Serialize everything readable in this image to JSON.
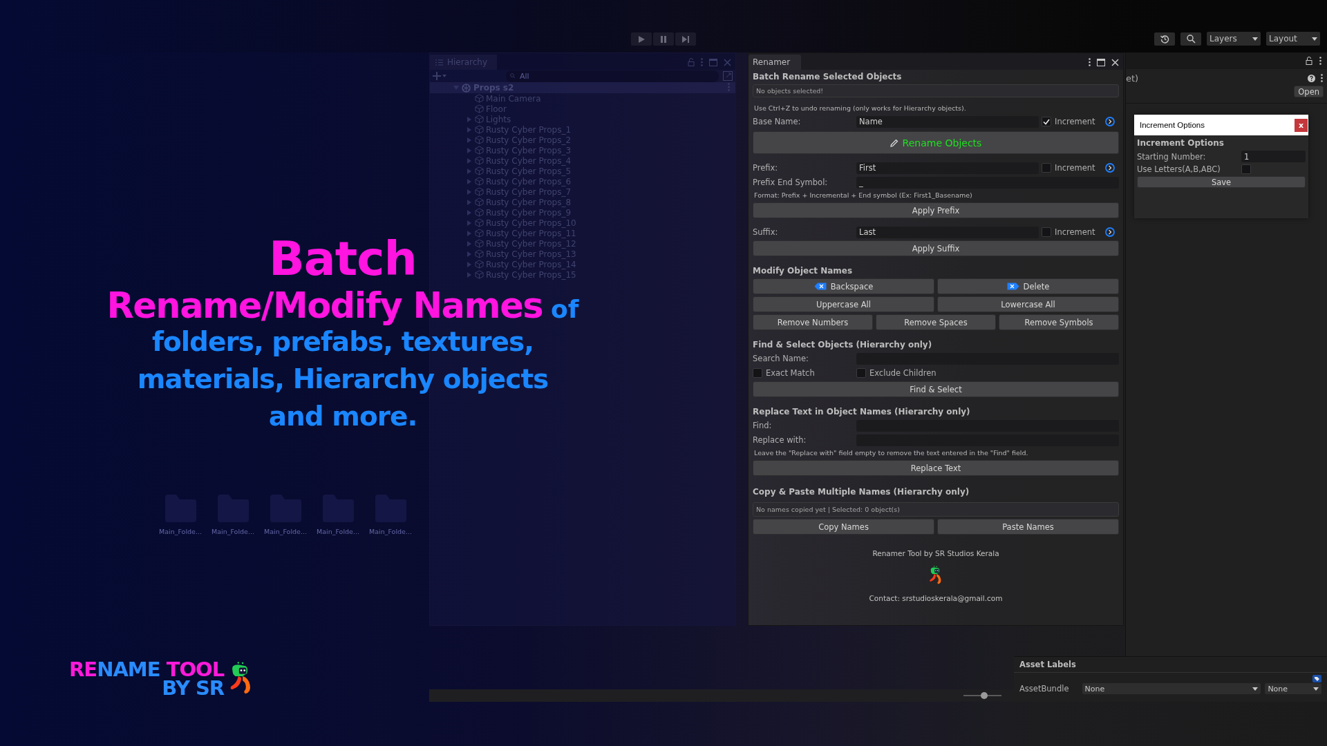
{
  "toolbar": {
    "layers": "Layers",
    "layout": "Layout"
  },
  "project": {
    "folders": [
      "Main_Folde...",
      "Main_Folde...",
      "Main_Folde...",
      "Main_Folde...",
      "Main_Folde..."
    ],
    "zoom_slider": {
      "level": 0.55
    }
  },
  "promo": {
    "title": "Batch",
    "subtitle": "Rename/Modify Names",
    "subtitle_tail": "of",
    "lines": [
      "folders, prefabs, textures,",
      "materials, Hierarchy objects",
      "and more."
    ]
  },
  "logo": {
    "lines": [
      [
        {
          "text": "RE",
          "color": "#ff1ad9"
        },
        {
          "text": "NAME",
          "color": "#2a8cff"
        },
        {
          "text": " TOOL",
          "color": "#ff1ad9"
        }
      ],
      [
        {
          "text": "BY SR",
          "color": "#2a8cff"
        }
      ]
    ]
  },
  "hierarchy": {
    "title": "Hierarchy",
    "search_placeholder": "All",
    "scene": {
      "name": "Props s2",
      "expanded": true,
      "children": [
        {
          "name": "Main Camera",
          "has_children": false
        },
        {
          "name": "Floor",
          "has_children": false
        },
        {
          "name": "Lights",
          "has_children": true
        },
        {
          "name": "Rusty Cyber Props_1",
          "has_children": true
        },
        {
          "name": "Rusty Cyber Props_2",
          "has_children": true
        },
        {
          "name": "Rusty Cyber Props_3",
          "has_children": true
        },
        {
          "name": "Rusty Cyber Props_4",
          "has_children": true
        },
        {
          "name": "Rusty Cyber Props_5",
          "has_children": true
        },
        {
          "name": "Rusty Cyber Props_6",
          "has_children": true
        },
        {
          "name": "Rusty Cyber Props_7",
          "has_children": true
        },
        {
          "name": "Rusty Cyber Props_8",
          "has_children": true
        },
        {
          "name": "Rusty Cyber Props_9",
          "has_children": true
        },
        {
          "name": "Rusty Cyber Props_10",
          "has_children": true
        },
        {
          "name": "Rusty Cyber Props_11",
          "has_children": true
        },
        {
          "name": "Rusty Cyber Props_12",
          "has_children": true
        },
        {
          "name": "Rusty Cyber Props_13",
          "has_children": true
        },
        {
          "name": "Rusty Cyber Props_14",
          "has_children": true
        },
        {
          "name": "Rusty Cyber Props_15",
          "has_children": true
        }
      ]
    }
  },
  "renamer": {
    "title": "Renamer",
    "heading": "Batch Rename Selected Objects",
    "status": "No objects selected!",
    "undo_note": "Use Ctrl+Z to undo renaming (only works for Hierarchy objects).",
    "base_name": {
      "label": "Base Name:",
      "value": "Name",
      "increment": {
        "label": "Increment",
        "checked": true
      }
    },
    "rename_button": "Rename Objects",
    "prefix": {
      "label": "Prefix:",
      "value": "First",
      "increment": {
        "label": "Increment",
        "checked": false
      }
    },
    "prefix_end": {
      "label": "Prefix End Symbol:",
      "value": "_"
    },
    "format_note": "Format: Prefix + Incremental + End symbol (Ex: First1_Basename)",
    "apply_prefix": "Apply Prefix",
    "suffix": {
      "label": "Suffix:",
      "value": "Last",
      "increment": {
        "label": "Increment",
        "checked": false
      }
    },
    "apply_suffix": "Apply Suffix",
    "modify": {
      "heading": "Modify Object Names",
      "rows": [
        [
          {
            "label": "Backspace",
            "kind": "backspace"
          },
          {
            "label": "Delete",
            "kind": "delete"
          }
        ],
        [
          {
            "label": "Uppercase All",
            "kind": "plain"
          },
          {
            "label": "Lowercase All",
            "kind": "plain"
          }
        ],
        [
          {
            "label": "Remove Numbers",
            "kind": "plain"
          },
          {
            "label": "Remove Spaces",
            "kind": "plain"
          },
          {
            "label": "Remove Symbols",
            "kind": "plain"
          }
        ]
      ]
    },
    "find_select": {
      "heading": "Find & Select Objects (Hierarchy only)",
      "search_label": "Search Name:",
      "options": [
        {
          "label": "Exact Match",
          "checked": false
        },
        {
          "label": "Exclude Children",
          "checked": false
        }
      ],
      "button": "Find & Select"
    },
    "replace": {
      "heading": "Replace Text in Object Names (Hierarchy only)",
      "find_label": "Find:",
      "replace_label": "Replace with:",
      "note": "Leave the \"Replace with\" field empty to remove the text entered in the \"Find\" field.",
      "button": "Replace Text"
    },
    "copy_paste": {
      "heading": "Copy & Paste Multiple Names (Hierarchy only)",
      "status": "No names copied yet | Selected: 0 object(s)",
      "buttons": [
        "Copy Names",
        "Paste Names"
      ]
    },
    "footer": {
      "credit": "Renamer Tool by SR Studios Kerala",
      "contact": "Contact: srstudioskerala@gmail.com"
    }
  },
  "inspector": {
    "title_fragment": "et)",
    "open_button": "Open",
    "asset_labels": "Asset Labels",
    "asset_bundle": {
      "label": "AssetBundle",
      "value": "None",
      "variant": "None"
    }
  },
  "dialog": {
    "title": "Increment Options",
    "close": "x",
    "heading": "Increment Options",
    "starting_number": {
      "label": "Starting Number:",
      "value": "1"
    },
    "use_letters": {
      "label": "Use Letters(A,B,ABC)",
      "checked": false
    },
    "save": "Save"
  }
}
